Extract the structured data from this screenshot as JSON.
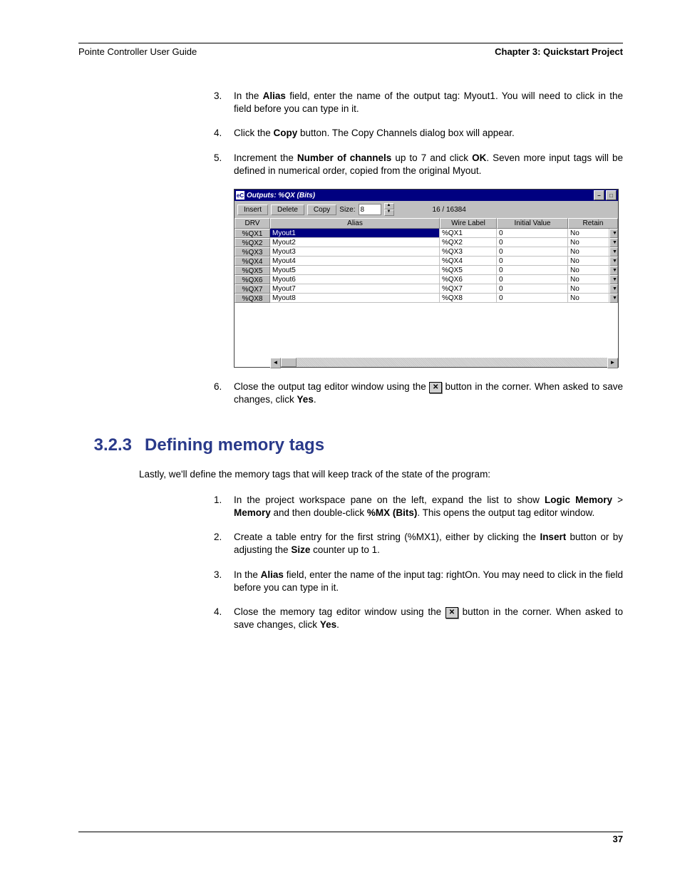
{
  "header": {
    "left": "Pointe Controller User Guide",
    "right": "Chapter 3: Quickstart Project"
  },
  "steps_a": {
    "s3": {
      "num": "3.",
      "pre": "In the ",
      "b1": "Alias",
      "post": " field, enter the name of the output tag: Myout1. You will need to click in the field before you can type in it."
    },
    "s4": {
      "num": "4.",
      "pre": "Click the ",
      "b1": "Copy",
      "post": " button. The Copy Channels dialog box will appear."
    },
    "s5": {
      "num": "5.",
      "pre": "Increment the ",
      "b1": "Number of channels",
      "mid": " up to 7 and click ",
      "b2": "OK",
      "post": ". Seven more input tags will be defined in numerical order, copied from the original Myout."
    },
    "s6": {
      "num": "6.",
      "pre": "Close the output tag editor window using the ",
      "post": " button in the corner. When asked to save changes, click ",
      "b1": "Yes",
      "end": "."
    }
  },
  "win": {
    "title": "Outputs: %QX (Bits)",
    "icon_label": "eC",
    "toolbar": {
      "insert": "Insert",
      "delete": "Delete",
      "copy": "Copy",
      "size_label": "Size:",
      "size_value": "8",
      "counter": "16 / 16384"
    },
    "columns": {
      "drv": "DRV",
      "alias": "Alias",
      "wire": "Wire Label",
      "init": "Initial Value",
      "retain": "Retain"
    },
    "rows": [
      {
        "drv": "%QX1",
        "alias": "Myout1",
        "wire": "%QX1",
        "init": "0",
        "retain": "No",
        "sel": true
      },
      {
        "drv": "%QX2",
        "alias": "Myout2",
        "wire": "%QX2",
        "init": "0",
        "retain": "No"
      },
      {
        "drv": "%QX3",
        "alias": "Myout3",
        "wire": "%QX3",
        "init": "0",
        "retain": "No"
      },
      {
        "drv": "%QX4",
        "alias": "Myout4",
        "wire": "%QX4",
        "init": "0",
        "retain": "No"
      },
      {
        "drv": "%QX5",
        "alias": "Myout5",
        "wire": "%QX5",
        "init": "0",
        "retain": "No"
      },
      {
        "drv": "%QX6",
        "alias": "Myout6",
        "wire": "%QX6",
        "init": "0",
        "retain": "No"
      },
      {
        "drv": "%QX7",
        "alias": "Myout7",
        "wire": "%QX7",
        "init": "0",
        "retain": "No"
      },
      {
        "drv": "%QX8",
        "alias": "Myout8",
        "wire": "%QX8",
        "init": "0",
        "retain": "No"
      }
    ]
  },
  "section": {
    "num": "3.2.3",
    "title": "Defining memory tags"
  },
  "intro": "Lastly, we'll define the memory tags that will keep track of the state of the program:",
  "steps_b": {
    "s1": {
      "num": "1.",
      "pre": "In the project workspace pane on the left, expand the list to show ",
      "b1": "Logic Memory",
      "gt": " > ",
      "b2": "Memory",
      "mid": " and then double-click ",
      "b3": "%MX (Bits)",
      "post": ". This opens the output tag editor window."
    },
    "s2": {
      "num": "2.",
      "pre": "Create a table entry for the first string (%MX1), either by clicking the ",
      "b1": "Insert",
      "mid": " button or by adjusting the ",
      "b2": "Size",
      "post": " counter up to 1."
    },
    "s3": {
      "num": "3.",
      "pre": "In the ",
      "b1": "Alias",
      "post": " field, enter the name of the input tag: rightOn. You may need to click in the field before you can type in it."
    },
    "s4": {
      "num": "4.",
      "pre": "Close the memory tag editor window using the ",
      "post": " button in the corner. When asked to save changes, click ",
      "b1": "Yes",
      "end": "."
    }
  },
  "footer": {
    "page": "37"
  },
  "glyphs": {
    "x": "✕",
    "min": "–",
    "max": "□",
    "up": "▲",
    "dn": "▼",
    "left": "◄",
    "right": "►"
  }
}
